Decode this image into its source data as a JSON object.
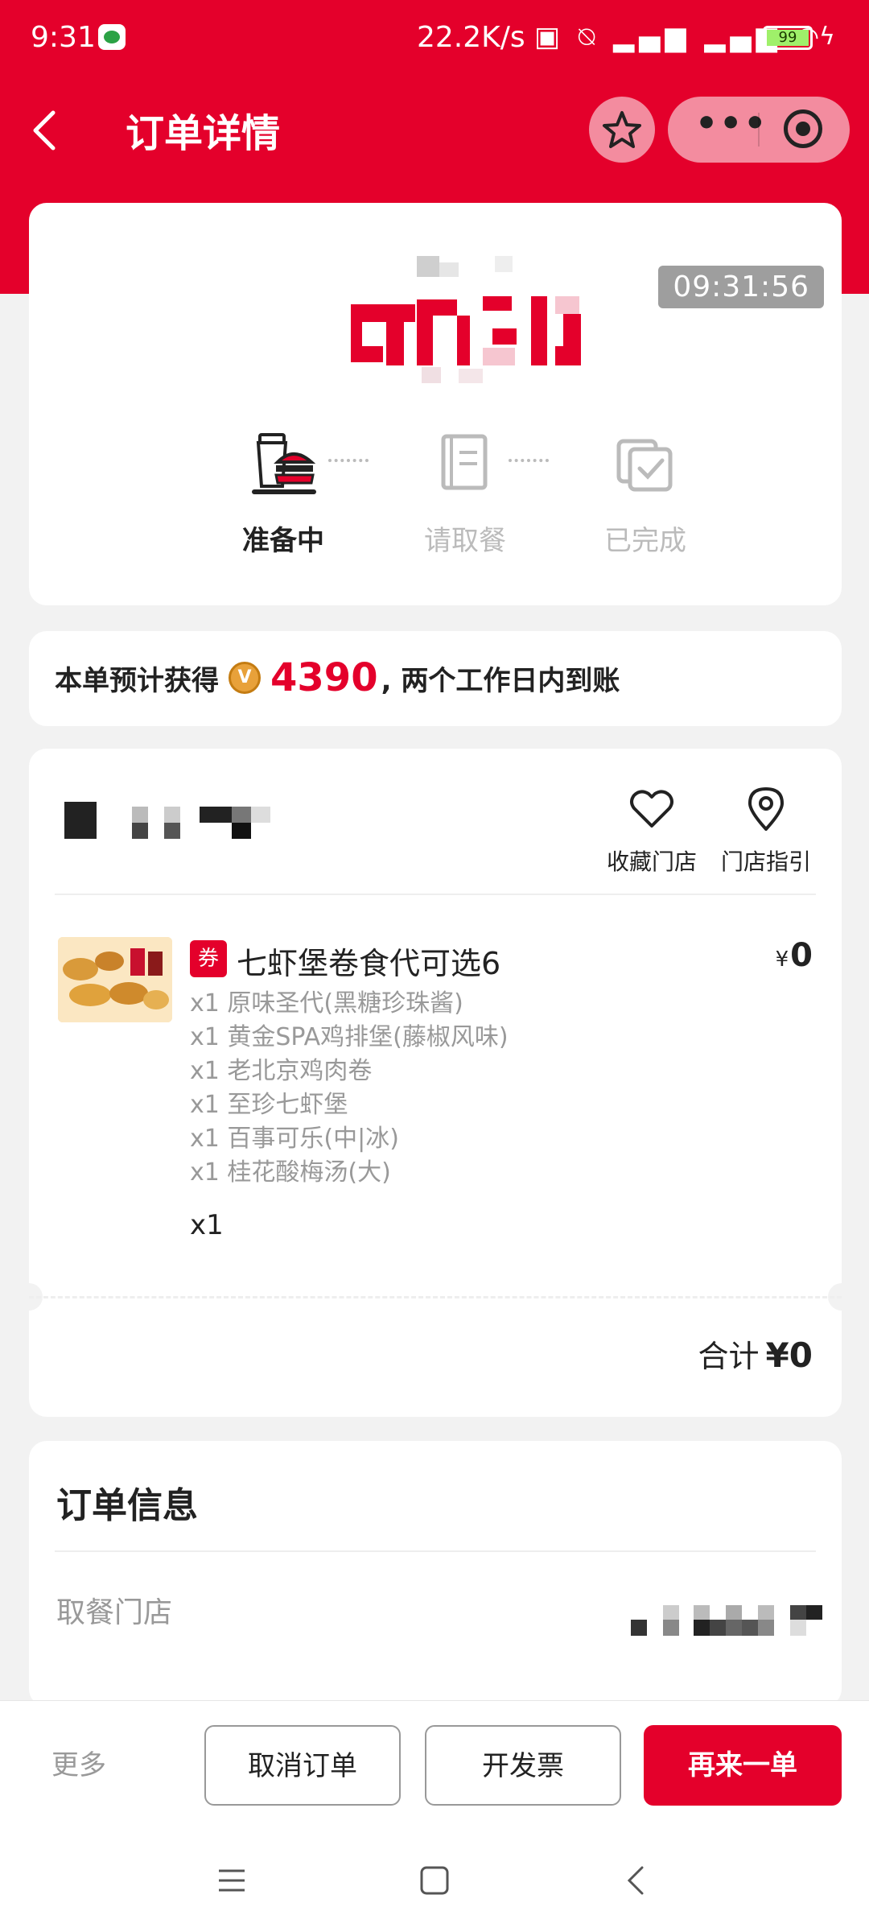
{
  "status_bar": {
    "time": "9:31",
    "network_speed": "22.2K/s",
    "battery": "99"
  },
  "header": {
    "title": "订单详情",
    "back_icon": "chevron-left-icon",
    "favorite_icon": "star-icon",
    "more_icon": "more-dots-icon",
    "close_icon": "target-icon"
  },
  "order_status": {
    "timer": "09:31:56",
    "steps": [
      {
        "label": "准备中",
        "icon": "food-tray-icon",
        "state": "active"
      },
      {
        "label": "请取餐",
        "icon": "book-icon",
        "state": "inactive"
      },
      {
        "label": "已完成",
        "icon": "done-icon",
        "state": "inactive"
      }
    ]
  },
  "points": {
    "prefix": "本单预计获得",
    "coin_symbol": "V",
    "amount": "4390",
    "suffix": ", 两个工作日内到账"
  },
  "store": {
    "favorite_label": "收藏门店",
    "directions_label": "门店指引"
  },
  "item": {
    "tag": "券",
    "name": "七虾堡卷食代可选6",
    "price_symbol": "¥",
    "price": "0",
    "sub_items": [
      "x1 原味圣代(黑糖珍珠酱)",
      "x1 黄金SPA鸡排堡(藤椒风味)",
      "x1 老北京鸡肉卷",
      "x1 至珍七虾堡",
      "x1 百事可乐(中|冰)",
      "x1 桂花酸梅汤(大)"
    ],
    "quantity": "x1"
  },
  "total": {
    "label": "合计",
    "amount": "¥0"
  },
  "order_info": {
    "title": "订单信息",
    "pickup_store_label": "取餐门店"
  },
  "actions": {
    "more": "更多",
    "cancel": "取消订单",
    "invoice": "开发票",
    "reorder": "再来一单"
  },
  "colors": {
    "brand_red": "#e4002b",
    "muted_gray": "#999999",
    "coin_gold": "#e8a13a"
  }
}
